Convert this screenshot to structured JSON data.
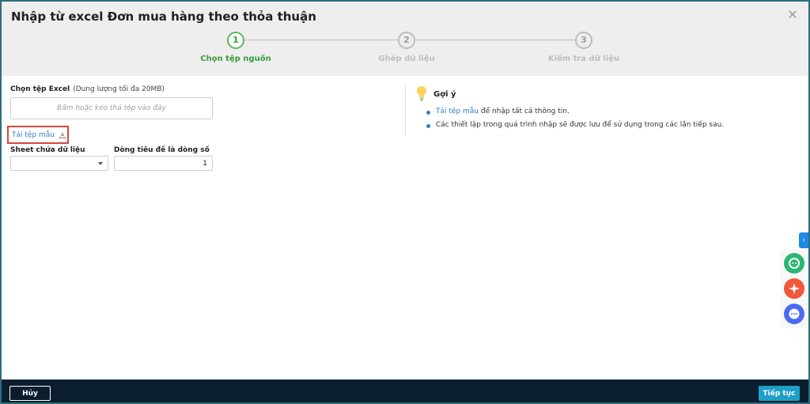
{
  "dialog": {
    "title": "Nhập từ excel Đơn mua hàng theo thỏa thuận",
    "close_icon": "close-icon"
  },
  "stepper": {
    "steps": [
      {
        "number": "1",
        "label": "Chọn tệp nguồn",
        "active": true
      },
      {
        "number": "2",
        "label": "Ghép dữ liệu",
        "active": false
      },
      {
        "number": "3",
        "label": "Kiểm tra dữ liệu",
        "active": false
      }
    ],
    "active_color": "#5cb85c"
  },
  "source": {
    "label": "Chọn tệp Excel",
    "size_note": "(Dung lượng tối đa 20MB)",
    "dropzone_text": "Bấm hoặc kéo thả tệp vào đây",
    "download_template": "Tải tệp mẫu",
    "sheet_label": "Sheet chứa dữ liệu",
    "sheet_value": "",
    "header_row_label": "Dòng tiêu đề là dòng số",
    "header_row_value": "1"
  },
  "hint": {
    "title": "Gợi ý",
    "item1_link": "Tải tệp mẫu",
    "item1_rest": " để nhập tất cả thông tin.",
    "item2": "Các thiết lập trong quá trình nhập sẽ được lưu để sử dụng trong các lần tiếp sau.",
    "bullet_color": "#2f7ec2"
  },
  "footer": {
    "cancel_label": "Hủy",
    "next_label": "Tiếp tục"
  },
  "colors": {
    "link": "#2f7ec2",
    "primary_button": "#1ea0c9",
    "footer_bg": "#0b1e2d",
    "highlight_border": "#d9463f"
  }
}
